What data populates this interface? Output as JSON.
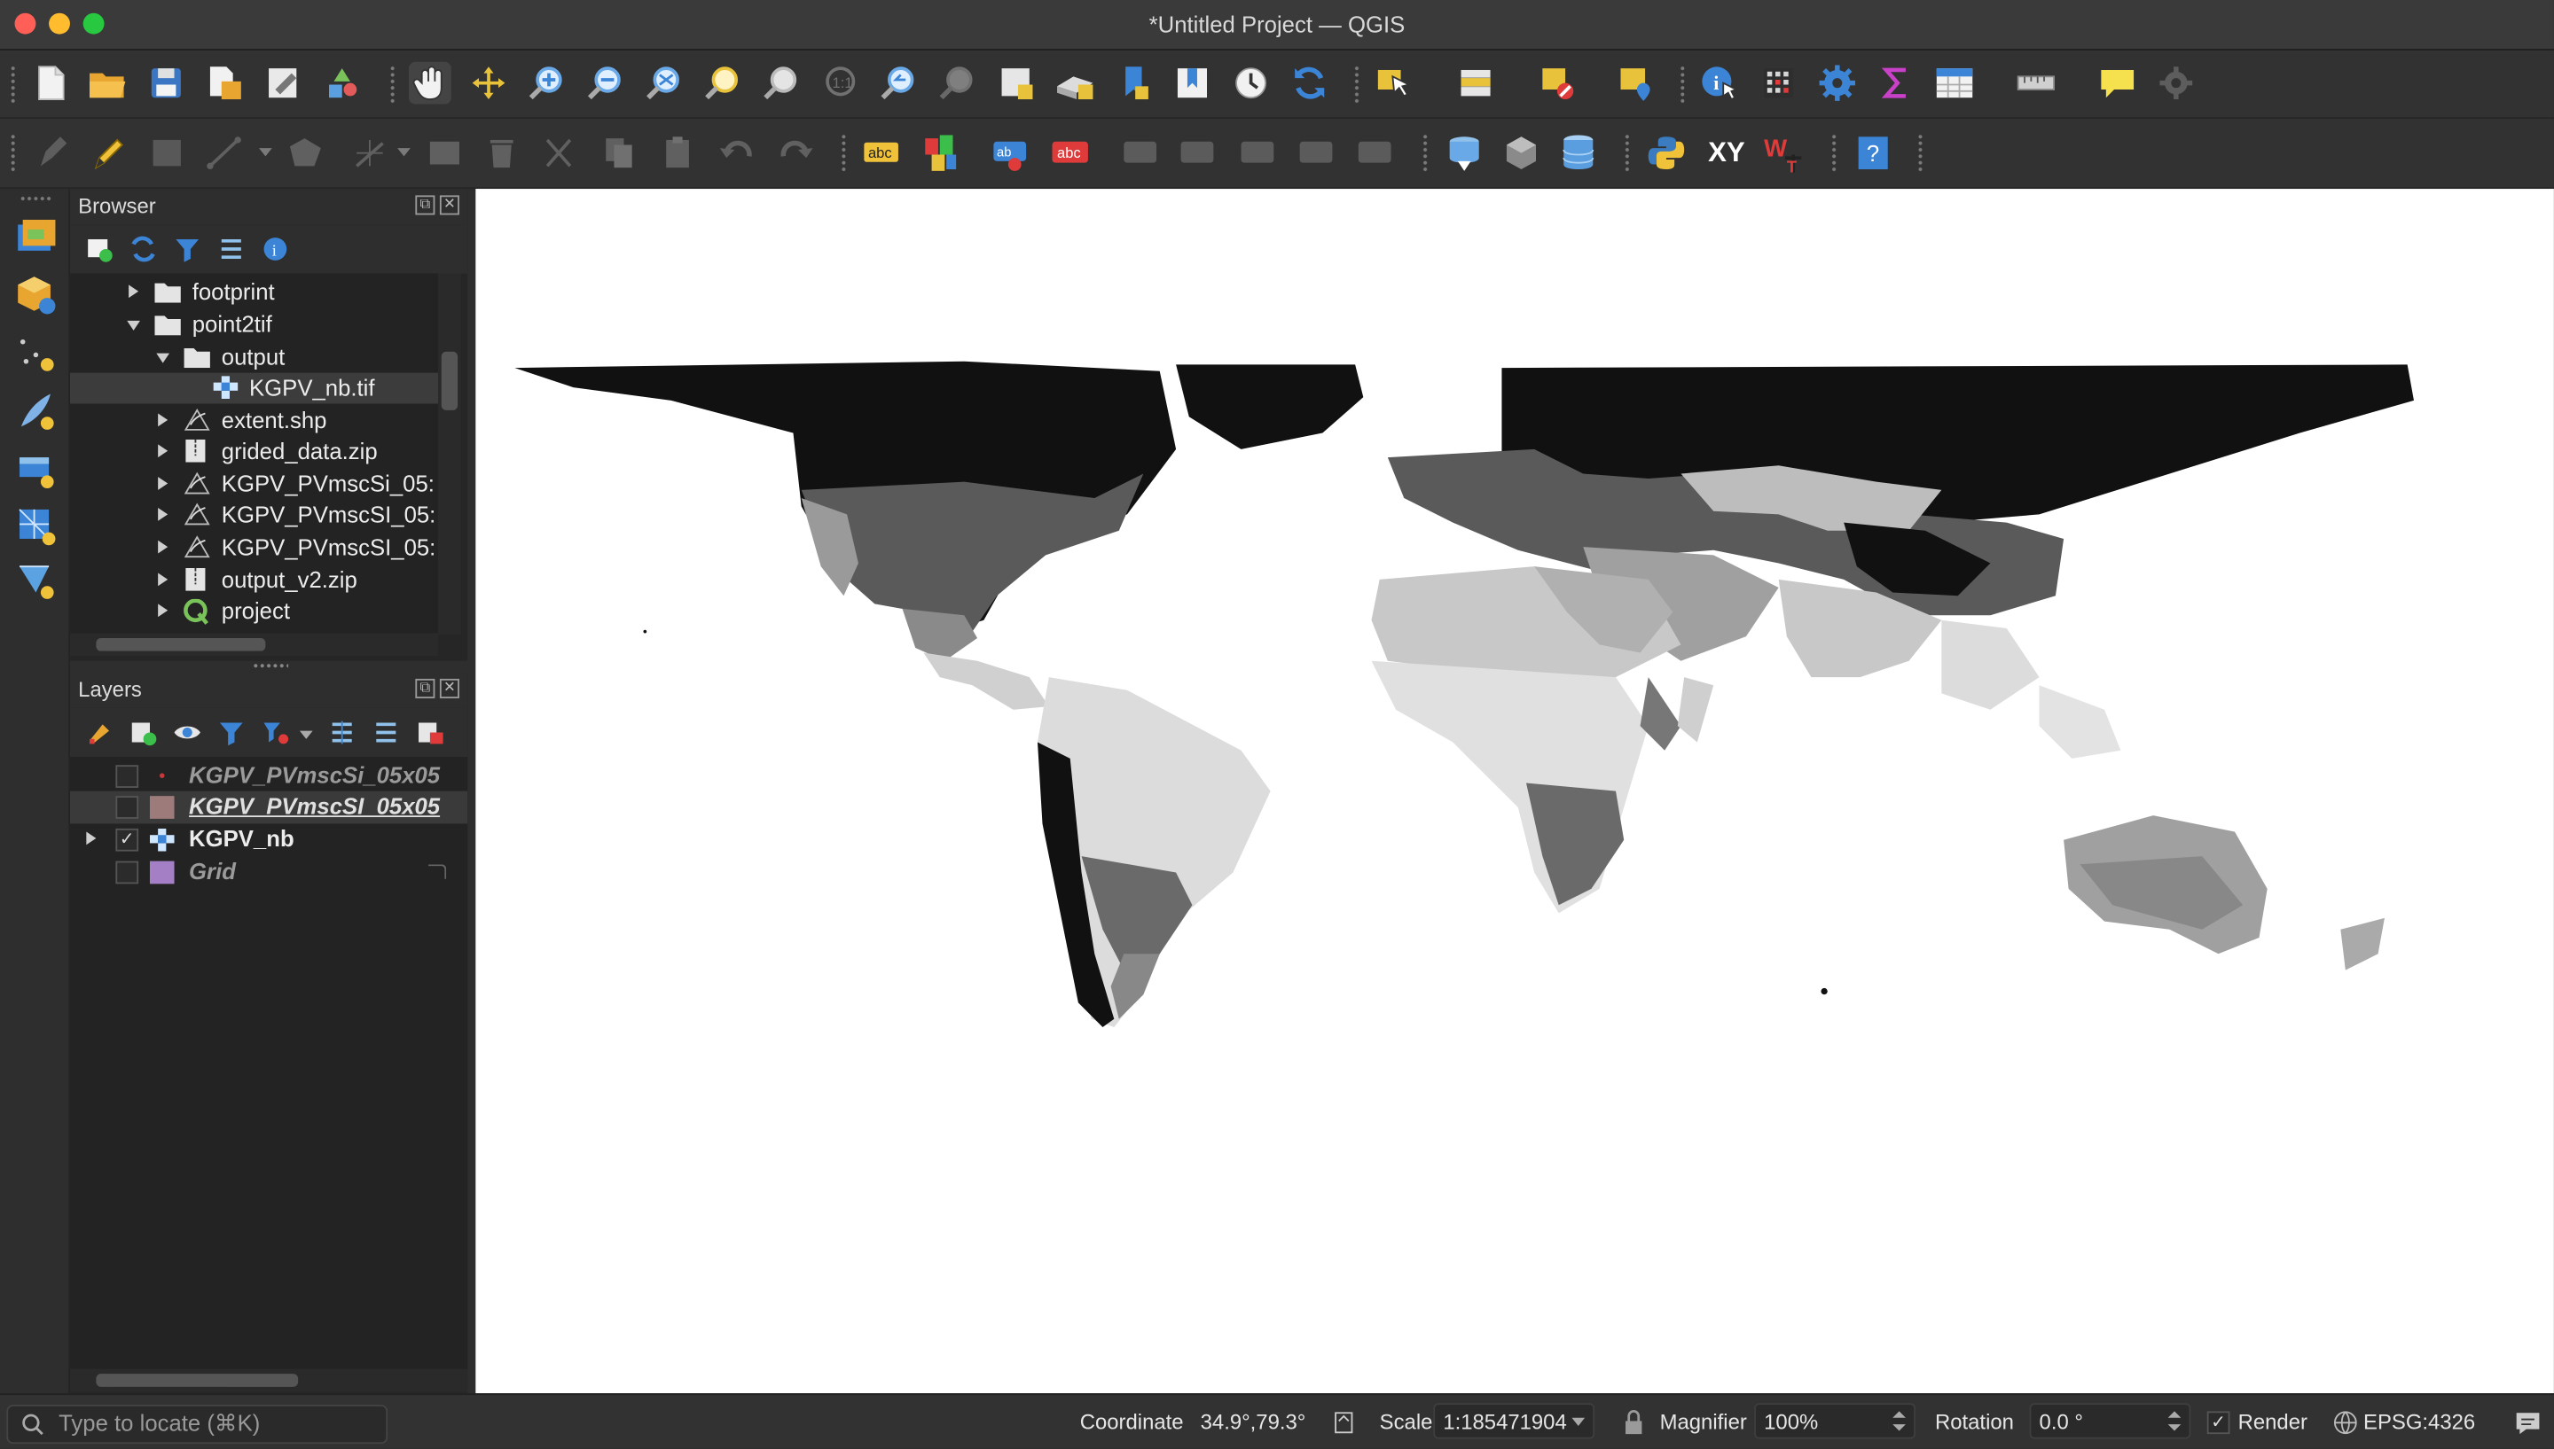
{
  "window": {
    "title": "*Untitled Project — QGIS"
  },
  "toolbar": {
    "row1_icons": [
      "new-project-icon",
      "open-project-icon",
      "save-project-icon",
      "save-as-icon",
      "print-layout-icon",
      "style-manager-icon",
      "pan-icon",
      "pan-to-selection-icon",
      "zoom-in-icon",
      "zoom-out-icon",
      "zoom-full-icon",
      "zoom-to-selection-icon",
      "zoom-to-layer-icon",
      "zoom-to-native-icon",
      "zoom-last-icon",
      "zoom-next-icon",
      "new-map-view-icon",
      "new-3d-view-icon",
      "spatial-bookmark-icon",
      "show-bookmarks-icon",
      "temporal-controller-icon",
      "refresh-icon",
      "select-features-icon",
      "select-by-value-icon",
      "deselect-icon",
      "select-location-icon",
      "identify-icon",
      "attribute-table-icon",
      "settings-icon",
      "statistics-icon",
      "open-table-icon",
      "measure-icon",
      "map-tips-icon",
      "actions-icon"
    ],
    "row2_icons": [
      "current-edits-icon",
      "toggle-editing-icon",
      "save-edits-icon",
      "digitize-icon",
      "add-polygon-icon",
      "vertex-tool-icon",
      "modify-attributes-icon",
      "delete-selected-icon",
      "cut-features-icon",
      "copy-features-icon",
      "paste-features-icon",
      "undo-icon",
      "redo-icon",
      "label-icon",
      "diagram-icon",
      "pin-labels-icon",
      "hide-labels-icon",
      "show-labels-icon",
      "move-label-icon",
      "rotate-label-icon",
      "change-label-icon",
      "db-manager-icon",
      "geopackage-icon",
      "database-icon",
      "python-console-icon",
      "xy-tool-icon",
      "wkt-icon",
      "help-icon"
    ],
    "row2_text": {
      "label": "abc",
      "xy": "XY",
      "wkt": "W",
      "help": "?"
    }
  },
  "browser": {
    "title": "Browser",
    "items": [
      {
        "label": "footprint",
        "kind": "folder",
        "expanded": false
      },
      {
        "label": "point2tif",
        "kind": "folder",
        "expanded": true
      },
      {
        "label": "output",
        "kind": "folder",
        "expanded": true
      },
      {
        "label": "KGPV_nb.tif",
        "kind": "raster",
        "selected": true
      },
      {
        "label": "extent.shp",
        "kind": "vector"
      },
      {
        "label": "grided_data.zip",
        "kind": "zip"
      },
      {
        "label": "KGPV_PVmscSi_05:",
        "kind": "vector"
      },
      {
        "label": "KGPV_PVmscSI_05:",
        "kind": "vector"
      },
      {
        "label": "KGPV_PVmscSI_05:",
        "kind": "vector"
      },
      {
        "label": "output_v2.zip",
        "kind": "zip"
      },
      {
        "label": "project",
        "kind": "qgis"
      }
    ]
  },
  "layers": {
    "title": "Layers",
    "items": [
      {
        "label": "KGPV_PVmscSi_05x05",
        "checked": false,
        "style": "italic",
        "swatch": "#c43a3a"
      },
      {
        "label": "KGPV_PVmscSI_05x05",
        "checked": false,
        "style": "bold-italic-underline",
        "swatch": "#9e7b7b"
      },
      {
        "label": "KGPV_nb",
        "checked": true,
        "style": "bold",
        "swatch": "raster"
      },
      {
        "label": "Grid",
        "checked": false,
        "style": "italic",
        "swatch": "#a57fc6"
      }
    ]
  },
  "status": {
    "locator_placeholder": "Type to locate (⌘K)",
    "coordinate_label": "Coordinate",
    "coordinate_value": "34.9°,79.3°",
    "scale_label": "Scale",
    "scale_value": "1:185471904",
    "magnifier_label": "Magnifier",
    "magnifier_value": "100%",
    "rotation_label": "Rotation",
    "rotation_value": "0.0 °",
    "render_label": "Render",
    "render_checked": true,
    "crs": "EPSG:4326"
  },
  "colors": {
    "accent": "#3b84d6",
    "raster_dark": "#111111",
    "raster_mid": "#5a5a5a",
    "raster_light": "#bdbdbd",
    "raster_pale": "#e3e3e3"
  }
}
